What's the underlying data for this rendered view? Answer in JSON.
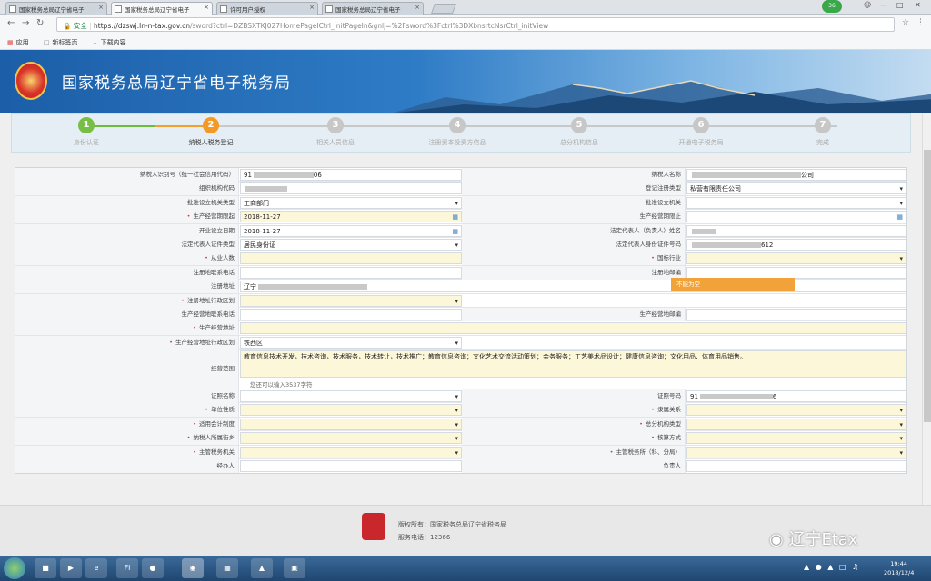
{
  "browser": {
    "tabs": [
      {
        "title": "国家税务总局辽宁省电子"
      },
      {
        "title": "国家税务总局辽宁省电子"
      },
      {
        "title": "许可用户授权"
      },
      {
        "title": "国家税务总局辽宁省电子"
      }
    ],
    "badge": "36",
    "security_label": "安全",
    "url_host": "https://dzswj.ln-n-tax.gov.cn",
    "url_path": "/sword?ctrl=DZBSXTKJ027HomePageICtrl_initPageIn&gnlj=%2Fsword%3Fctrl%3DXbnsrtcNsrCtrl_initView",
    "bookmarks": [
      "应用",
      "新标签页",
      "下载内容"
    ]
  },
  "header": {
    "title": "国家税务总局辽宁省电子税务局"
  },
  "wizard": {
    "steps": [
      {
        "num": "1",
        "label": "身份认证"
      },
      {
        "num": "2",
        "label": "纳税人税务登记"
      },
      {
        "num": "3",
        "label": "相关人员信息"
      },
      {
        "num": "4",
        "label": "注册资本投资方信息"
      },
      {
        "num": "5",
        "label": "总分机构信息"
      },
      {
        "num": "6",
        "label": "开通电子税务局"
      },
      {
        "num": "7",
        "label": "完成"
      }
    ]
  },
  "form": {
    "taxpayer_id_label": "纳税人识别号（统一社会信用代码）",
    "taxpayer_id_prefix": "91",
    "taxpayer_id_suffix": "06",
    "taxpayer_name_label": "纳税人名称",
    "taxpayer_name_suffix": "公司",
    "org_code_label": "组织机构代码",
    "reg_type_label": "登记注册类型",
    "reg_type_value": "私营有限责任公司",
    "approve_type_label": "批准设立机关类型",
    "approve_type_value": "工商部门",
    "approve_org_label": "批准设立机关",
    "prod_start_label": "生产经营期限起",
    "prod_start_value": "2018-11-27",
    "prod_end_label": "生产经营期限止",
    "open_date_label": "开业设立日期",
    "open_date_value": "2018-11-27",
    "legal_name_label": "法定代表人（负责人）姓名",
    "legal_id_type_label": "法定代表人证件类型",
    "legal_id_type_value": "居民身份证",
    "legal_id_no_label": "法定代表人身份证件号码",
    "legal_id_no_suffix": "612",
    "employees_label": "从业人数",
    "industry_label": "国标行业",
    "reg_phone_label": "注册地联系电话",
    "reg_zip_label": "注册地邮编",
    "tip_text": "不能为空",
    "reg_addr_label": "注册地址",
    "reg_addr_value": "辽宁",
    "reg_region_label": "注册地址行政区划",
    "prod_phone_label": "生产经营地联系电话",
    "prod_zip_label": "生产经营地邮编",
    "prod_addr_label": "生产经营地址",
    "prod_region_label": "生产经营地址行政区划",
    "prod_region_value": "铁西区",
    "scope_label": "经营范围",
    "scope_value": "教育信息技术开发，技术咨询，技术服务，技术转让，技术推广；教育信息咨询；文化艺术交流活动策划；会务服务；工艺美术品设计；健康信息咨询；文化用品、体育用品销售。",
    "scope_hint": "您还可以输入3537字符",
    "cert_name_label": "证照名称",
    "cert_no_label": "证照号码",
    "cert_no_prefix": "91",
    "cert_no_suffix": "6",
    "unit_nature_label": "单位性质",
    "affiliation_label": "隶属关系",
    "accounting_label": "适用会计制度",
    "branch_type_label": "总分机构类型",
    "street_label": "纳税人所属街乡",
    "calc_method_label": "核算方式",
    "tax_office_label": "主管税务机关",
    "tax_branch_label": "主管税务所（科、分局）",
    "handler_label": "经办人",
    "responsible_label": "负责人"
  },
  "footer": {
    "copyright": "版权所有：国家税务总局辽宁省税务局",
    "phone": "服务电话：12366"
  },
  "watermark": "辽宁Etax",
  "taskbar": {
    "time": "19:44",
    "date": "2018/12/4"
  },
  "colors": {
    "header_blue": "#2f7cc6",
    "step_done": "#76be45",
    "step_current": "#f39a26",
    "required_bg": "#fdf7d9",
    "tip_orange": "#f1a33a"
  }
}
